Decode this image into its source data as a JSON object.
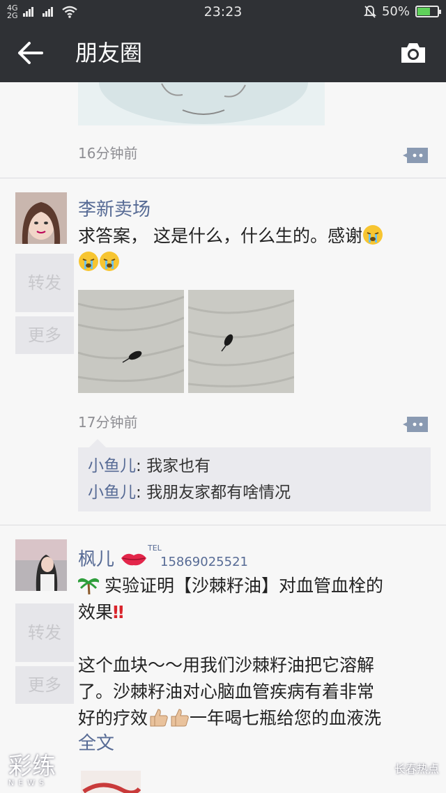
{
  "status_bar": {
    "network_left": "4G",
    "network_left2": "2G",
    "time": "23:23",
    "battery": "50%"
  },
  "nav": {
    "title": "朋友圈"
  },
  "posts": [
    {
      "time": "16分钟前"
    },
    {
      "name": "李新卖场",
      "text": "求答案， 这是什么，什么生的。感谢",
      "forward_label": "转发",
      "more_label": "更多",
      "time": "17分钟前",
      "comments": [
        {
          "author": "小鱼儿",
          "text": "我家也有"
        },
        {
          "author": "小鱼儿",
          "text": "我朋友家都有啥情况"
        }
      ]
    },
    {
      "name": "枫儿",
      "tel_label": "TEL",
      "phone": "15869025521",
      "line1": "实验证明【沙棘籽油】对血管血栓的",
      "line2": "效果",
      "para2_line1": "这个血块～～用我们沙棘籽油把它溶解",
      "para2_line2": "了。沙棘籽油对心脑血管疾病有着非常",
      "para2_line3_a": "好的疗效",
      "para2_line3_b": "一年喝七瓶给您的血液洗",
      "full_text_link": "全文",
      "forward_label": "转发",
      "more_label": "更多"
    }
  ],
  "watermarks": {
    "left_logo": "彩练",
    "left_sub": "NEWS",
    "right_text": "长春热点"
  }
}
